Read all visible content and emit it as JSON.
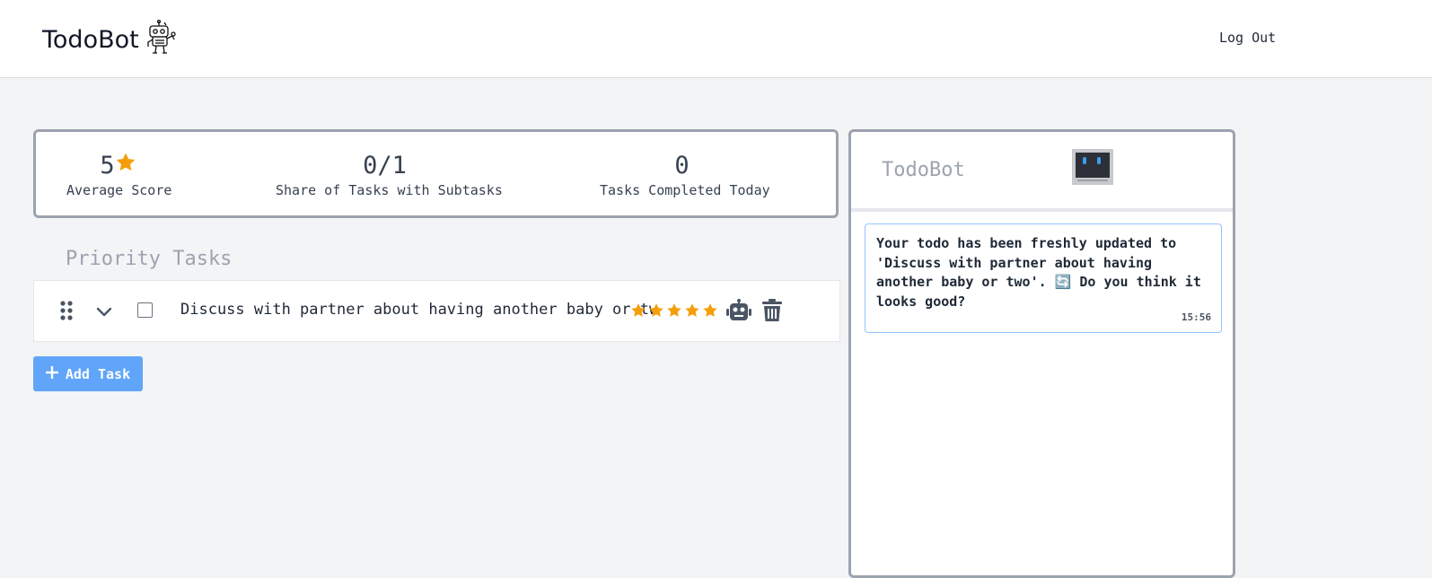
{
  "header": {
    "brand": "TodoBot",
    "logout_label": "Log Out"
  },
  "stats": {
    "average_score": {
      "value": "5",
      "label": "Average Score"
    },
    "subtasks_share": {
      "value": "0/1",
      "label": "Share of Tasks with Subtasks"
    },
    "completed_today": {
      "value": "0",
      "label": "Tasks Completed Today"
    }
  },
  "tasks": {
    "title": "Priority Tasks",
    "items": [
      {
        "text": "Discuss with partner about having another baby or two",
        "rating": 5,
        "max_rating": 5,
        "completed": false
      }
    ],
    "add_label": "Add Task"
  },
  "chat": {
    "title": "TodoBot",
    "messages": [
      {
        "text": "Your todo has been freshly updated to 'Discuss with partner about having another baby or two'. 🔄 Do you think it looks good?",
        "time": "15:56"
      }
    ]
  },
  "colors": {
    "accent": "#60a5fa",
    "star": "#f59e0b",
    "border": "#9ca3af",
    "background": "#f3f4f6"
  },
  "icons": [
    "robot-logo-icon",
    "star-icon",
    "drag-handle-icon",
    "chevron-down-icon",
    "robot-icon",
    "trash-icon",
    "plus-icon",
    "robot-avatar-icon"
  ]
}
